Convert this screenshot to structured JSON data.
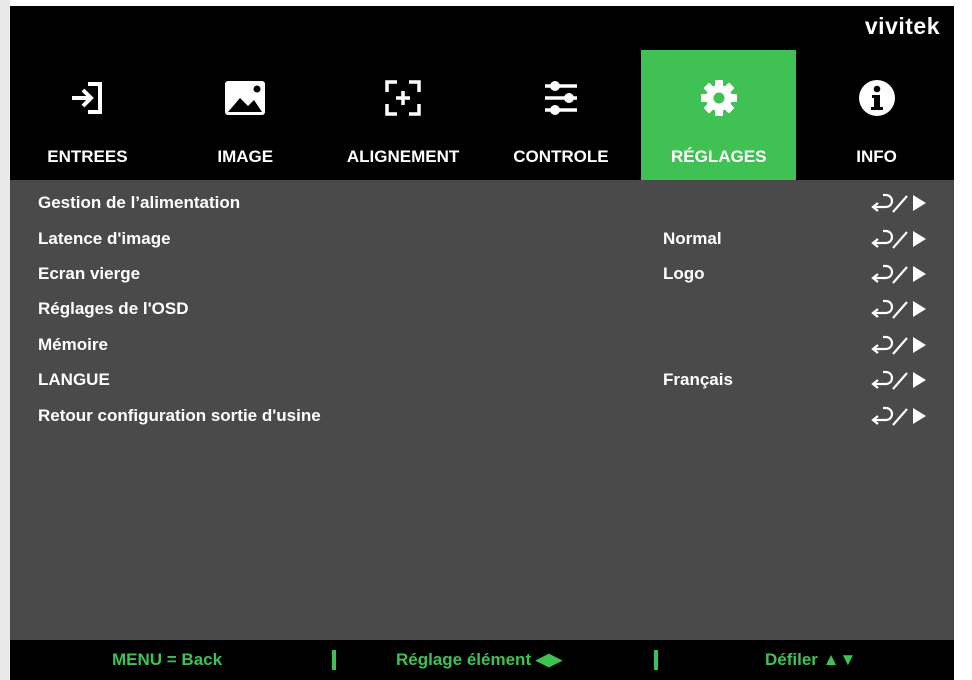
{
  "brand": {
    "logo_text": "vivitek"
  },
  "tabs": [
    {
      "label": "ENTREES",
      "icon": "input-icon",
      "active": false
    },
    {
      "label": "IMAGE",
      "icon": "image-icon",
      "active": false
    },
    {
      "label": "ALIGNEMENT",
      "icon": "alignment-icon",
      "active": false
    },
    {
      "label": "CONTROLE",
      "icon": "sliders-icon",
      "active": false
    },
    {
      "label": "RÉGLAGES",
      "icon": "gear-icon",
      "active": true
    },
    {
      "label": "INFO",
      "icon": "info-icon",
      "active": false
    }
  ],
  "menu": {
    "items": [
      {
        "label": "Gestion de l’alimentation",
        "value": ""
      },
      {
        "label": "Latence d'image",
        "value": "Normal"
      },
      {
        "label": "Ecran vierge",
        "value": "Logo"
      },
      {
        "label": "Réglages de l'OSD",
        "value": ""
      },
      {
        "label": "Mémoire",
        "value": ""
      },
      {
        "label": "LANGUE",
        "value": "Français"
      },
      {
        "label": "Retour configuration sortie d'usine",
        "value": ""
      }
    ]
  },
  "footer": {
    "back": "MENU = Back",
    "adjust": "Réglage élément ◀▶",
    "scroll": "Défiler ▲▼"
  },
  "colors": {
    "accent": "#3fc153",
    "background": "#4a4a4a",
    "bar": "#000000",
    "text": "#ffffff"
  }
}
